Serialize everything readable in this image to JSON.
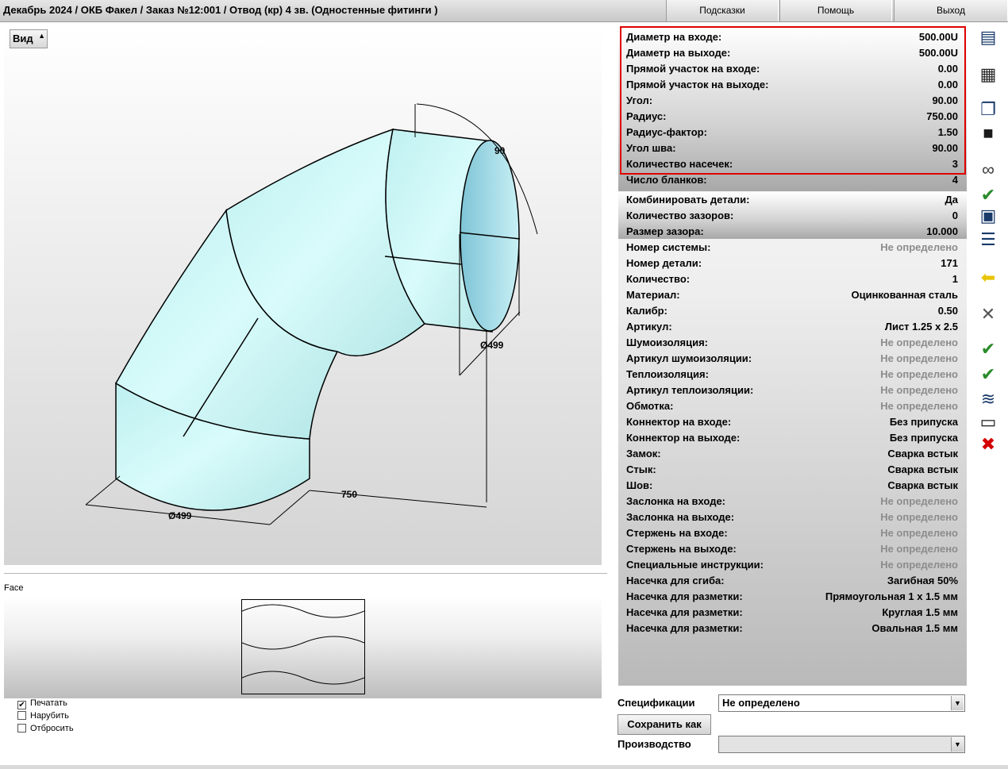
{
  "title": "Декабрь 2024 / ОКБ Факел / Заказ №12:001 / Отвод (кр) 4 зв. (Одностенные фитинги )",
  "top_buttons": {
    "hints": "Подсказки",
    "help": "Помощь",
    "exit": "Выход"
  },
  "view": {
    "button_label": "Вид",
    "dims": {
      "angle": "90",
      "outlet_diameter": "Ø499",
      "inlet_diameter": "Ø499",
      "radius": "750"
    },
    "colors": {
      "pipe": "#c9f6f6",
      "opening": "#a6dfe8"
    }
  },
  "face": {
    "label": "Face",
    "checkboxes": [
      {
        "label": "Печатать",
        "checked": true
      },
      {
        "label": "Нарубить",
        "checked": false
      },
      {
        "label": "Отбросить",
        "checked": false
      }
    ]
  },
  "properties": {
    "geometry": [
      {
        "label": "Диаметр на входе:",
        "value": "500.00U"
      },
      {
        "label": "Диаметр на выходе:",
        "value": "500.00U"
      },
      {
        "label": "Прямой участок на входе:",
        "value": "0.00"
      },
      {
        "label": "Прямой участок на выходе:",
        "value": "0.00"
      },
      {
        "label": "Угол:",
        "value": "90.00"
      },
      {
        "label": "Радиус:",
        "value": "750.00"
      },
      {
        "label": "Радиус-фактор:",
        "value": "1.50"
      },
      {
        "label": "Угол шва:",
        "value": "90.00"
      },
      {
        "label": "Количество насечек:",
        "value": "3"
      },
      {
        "label": "Число бланков:",
        "value": "4"
      }
    ],
    "combine": [
      {
        "label": "Комбинировать детали:",
        "value": "Да"
      },
      {
        "label": "Количество зазоров:",
        "value": "0"
      },
      {
        "label": "Размер зазора:",
        "value": "10.000"
      }
    ],
    "details": [
      {
        "label": "Номер системы:",
        "value": "Не определено",
        "undefined": true
      },
      {
        "label": "Номер детали:",
        "value": "171"
      },
      {
        "label": "Количество:",
        "value": "1"
      },
      {
        "label": "Материал:",
        "value": "Оцинкованная сталь"
      },
      {
        "label": "Калибр:",
        "value": "0.50"
      },
      {
        "label": "Артикул:",
        "value": "Лист 1.25 x 2.5"
      },
      {
        "label": "Шумоизоляция:",
        "value": "Не определено",
        "undefined": true
      },
      {
        "label": "Артикул шумоизоляции:",
        "value": "Не определено",
        "undefined": true
      },
      {
        "label": "Теплоизоляция:",
        "value": "Не определено",
        "undefined": true
      },
      {
        "label": "Артикул теплоизоляции:",
        "value": "Не определено",
        "undefined": true
      },
      {
        "label": "Обмотка:",
        "value": "Не определено",
        "undefined": true
      },
      {
        "label": "Коннектор на входе:",
        "value": "Без припуска"
      },
      {
        "label": "Коннектор на выходе:",
        "value": "Без припуска"
      },
      {
        "label": "Замок:",
        "value": "Сварка встык"
      },
      {
        "label": "Стык:",
        "value": "Сварка встык"
      },
      {
        "label": "Шов:",
        "value": "Сварка встык"
      },
      {
        "label": "Заслонка на входе:",
        "value": "Не определено",
        "undefined": true
      },
      {
        "label": "Заслонка на выходе:",
        "value": "Не определено",
        "undefined": true
      },
      {
        "label": "Стержень на входе:",
        "value": "Не определено",
        "undefined": true
      },
      {
        "label": "Стержень на выходе:",
        "value": "Не определено",
        "undefined": true
      },
      {
        "label": "Специальные инструкции:",
        "value": "Не определено",
        "undefined": true
      },
      {
        "label": "Насечка для сгиба:",
        "value": "Загибная 50%"
      },
      {
        "label": "Насечка для разметки:",
        "value": "Прямоугольная 1 x 1.5 мм"
      },
      {
        "label": "Насечка для разметки:",
        "value": "Круглая 1.5 мм"
      },
      {
        "label": "Насечка для разметки:",
        "value": "Овальная 1.5 мм"
      }
    ],
    "highlight_color": "#e00000"
  },
  "bottom": {
    "spec_label": "Спецификации",
    "spec_value": "Не определено",
    "save_as": "Сохранить как",
    "production_label": "Производство",
    "production_value": ""
  },
  "toolbar_icons": [
    "document-view-icon",
    "document-grid-icon",
    "document-stack-icon",
    "save-icon",
    "glasses-icon",
    "note-check-icon",
    "document-print-icon",
    "report-icon",
    "back-arrow-icon",
    "cancel-x-icon",
    "document-check-icon",
    "documents-check-icon",
    "wave-document-icon",
    "open-book-icon",
    "cut-delete-icon"
  ]
}
